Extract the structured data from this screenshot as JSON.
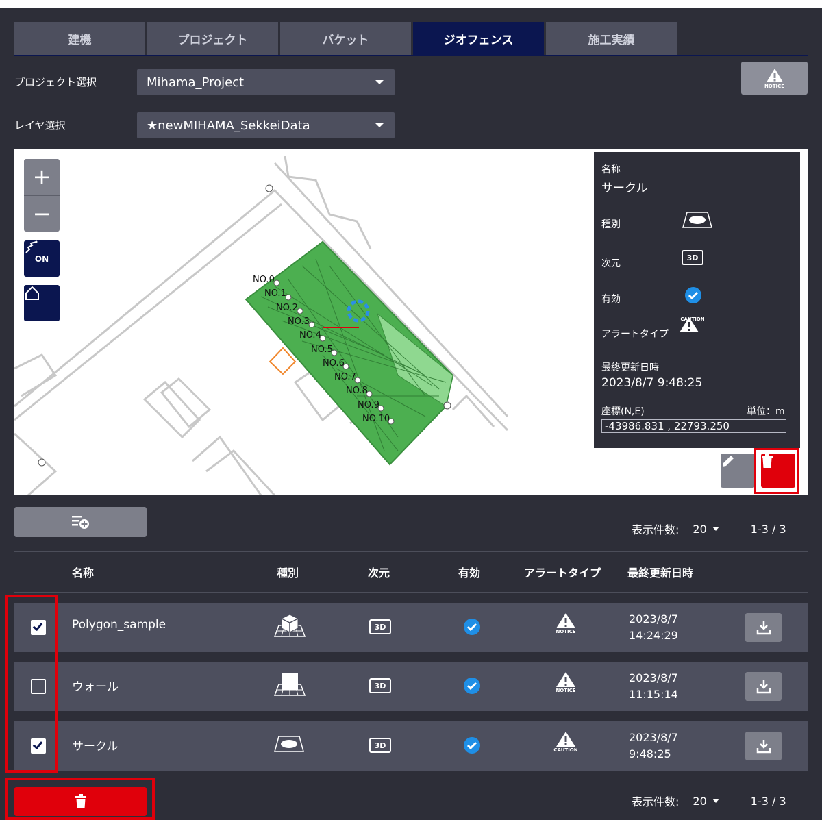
{
  "tabs": [
    {
      "label": "建機"
    },
    {
      "label": "プロジェクト"
    },
    {
      "label": "バケット"
    },
    {
      "label": "ジオフェンス",
      "active": true
    },
    {
      "label": "施工実績"
    }
  ],
  "project_select": {
    "label": "プロジェクト選択",
    "value": "Mihama_Project"
  },
  "layer_select": {
    "label": "レイヤ選択",
    "value": "★newMIHAMA_SekkeiData"
  },
  "notice_button": {
    "icon": "notice-warning-icon",
    "caption": "NOTICE"
  },
  "map": {
    "zoom_in": "+",
    "zoom_out": "−",
    "snap_label": "ON",
    "station_labels": [
      "NO.0",
      "NO.1",
      "NO.2",
      "NO.3",
      "NO.4",
      "NO.5",
      "NO.6",
      "NO.7",
      "NO.8",
      "NO.9",
      "NO.10"
    ]
  },
  "info_panel": {
    "name_label": "名称",
    "name_value": "サークル",
    "type_label": "種別",
    "dimension_label": "次元",
    "dimension_value": "3D",
    "enabled_label": "有効",
    "alert_type_label": "アラートタイプ",
    "alert_caption": "CAUTION",
    "updated_label": "最終更新日時",
    "updated_value": "2023/8/7 9:48:25",
    "coord_label": "座標(N,E)",
    "unit_label": "単位：m",
    "coord_value": "-43986.831 , 22793.250"
  },
  "pager_top": {
    "count_label": "表示件数:",
    "count_value": "20",
    "range": "1-3 / 3"
  },
  "pager_bottom": {
    "count_label": "表示件数:",
    "count_value": "20",
    "range": "1-3 / 3"
  },
  "table": {
    "headers": {
      "name": "名称",
      "type": "種別",
      "dimension": "次元",
      "enabled": "有効",
      "alert_type": "アラートタイプ",
      "updated": "最終更新日時"
    },
    "rows": [
      {
        "checked": true,
        "name": "Polygon_sample",
        "type_icon": "polygon-solid-icon",
        "dimension": "3D",
        "alert_caption": "NOTICE",
        "date": "2023/8/7",
        "time": "14:24:29"
      },
      {
        "checked": false,
        "name": "ウォール",
        "type_icon": "wall-icon",
        "dimension": "3D",
        "alert_caption": "NOTICE",
        "date": "2023/8/7",
        "time": "11:15:14"
      },
      {
        "checked": true,
        "name": "サークル",
        "type_icon": "circle-icon",
        "dimension": "3D",
        "alert_caption": "CAUTION",
        "date": "2023/8/7",
        "time": "9:48:25"
      }
    ]
  },
  "colors": {
    "background": "#2d2e38",
    "tab": "#4d4f5e",
    "tab_active": "#0b1650",
    "danger": "#e0000b",
    "enabled_check": "#1f8fe6",
    "geofence_fill": "#4caf50"
  }
}
